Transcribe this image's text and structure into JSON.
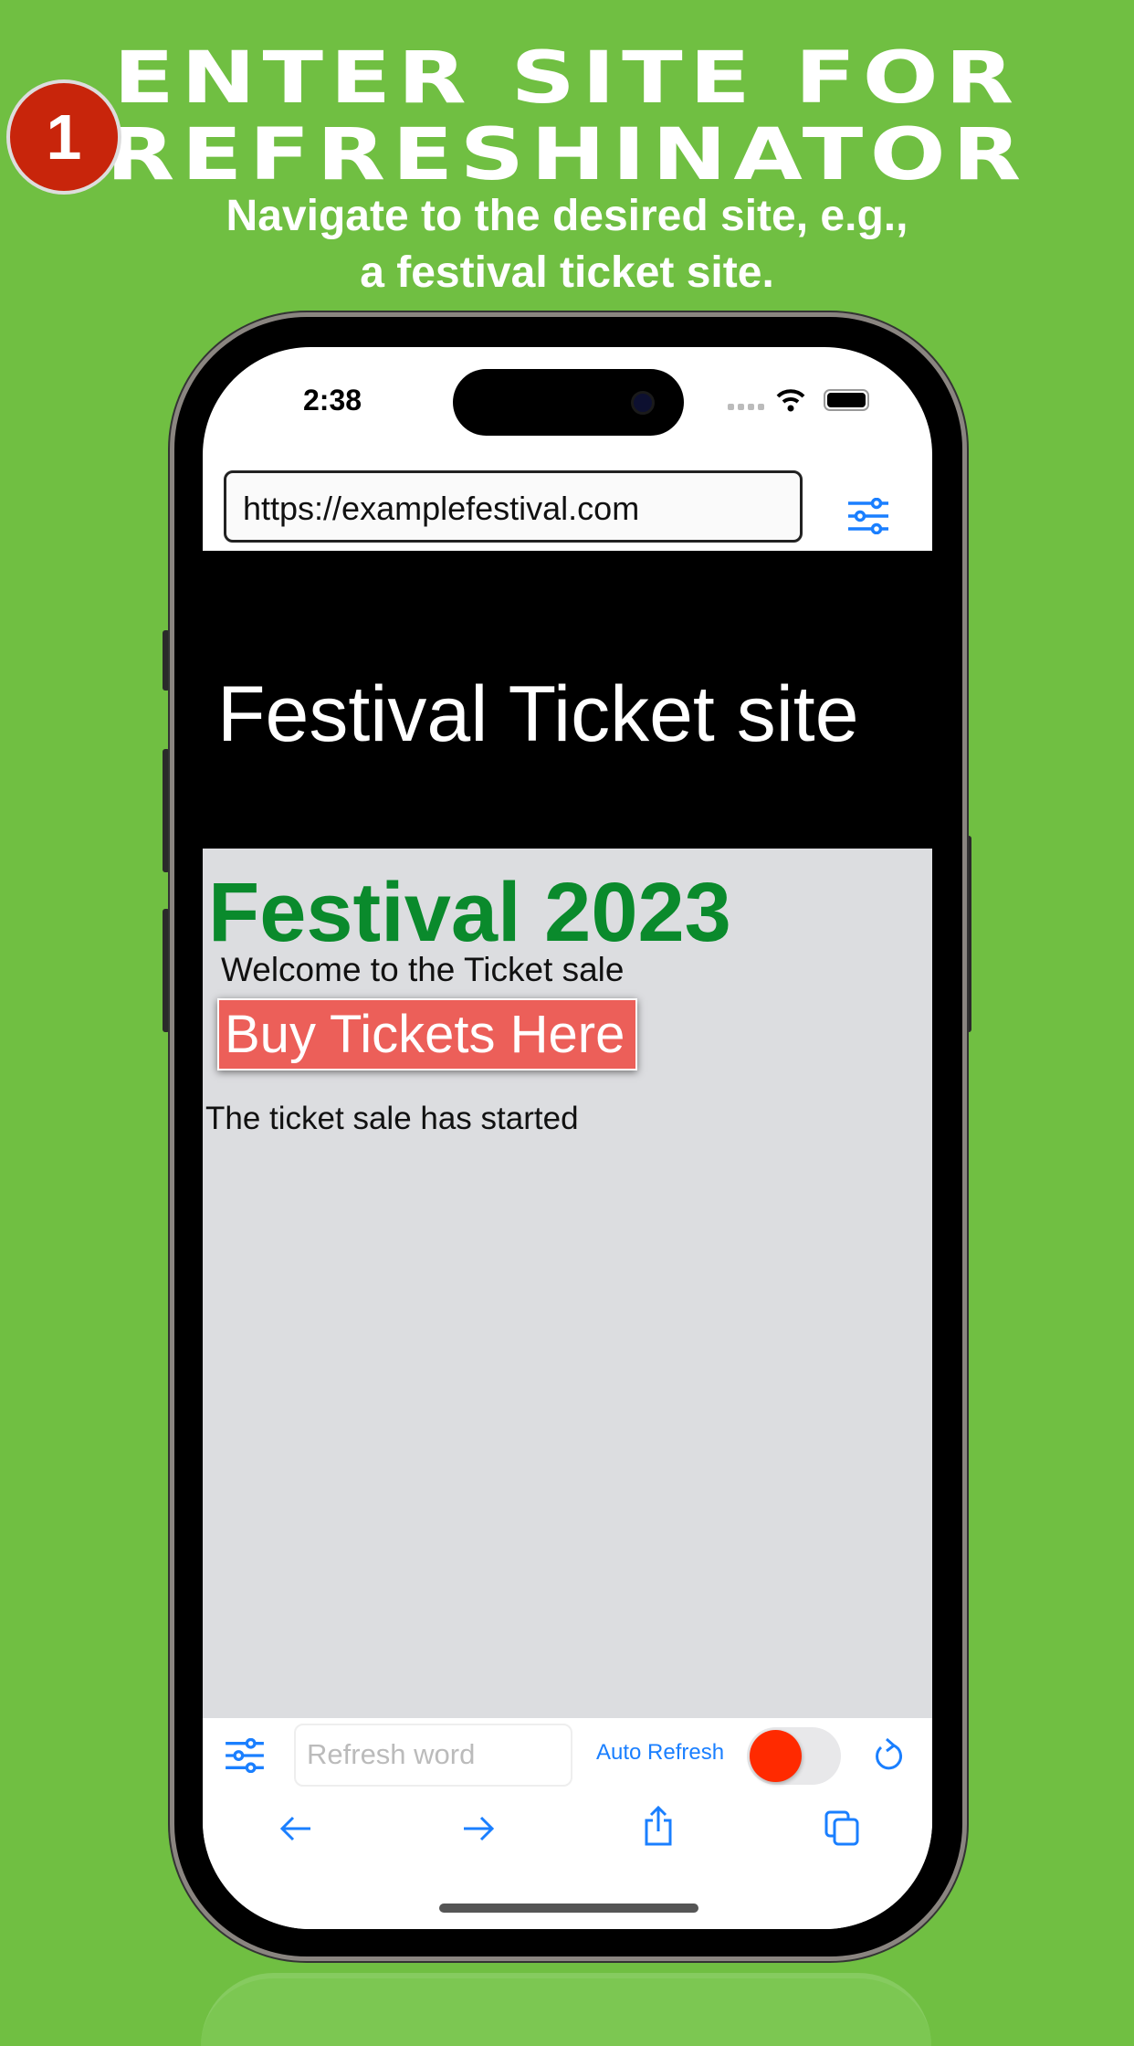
{
  "promo": {
    "step_number": "1",
    "title_line1": "ENTER SITE FOR",
    "title_line2": "REFRESHINATOR",
    "subtitle_line1": "Navigate to the desired site, e.g.,",
    "subtitle_line2": "a festival ticket site."
  },
  "status_bar": {
    "time": "2:38"
  },
  "browser": {
    "url": "https://examplefestival.com"
  },
  "site": {
    "header": "Festival Ticket site",
    "heading": "Festival 2023",
    "welcome": "Welcome to the Ticket sale",
    "buy_button": "Buy Tickets Here",
    "status": "The ticket sale has started"
  },
  "toolbar": {
    "refresh_word_placeholder": "Refresh word",
    "auto_refresh_label": "Auto Refresh",
    "auto_refresh_on": false
  },
  "colors": {
    "background": "#70bf42",
    "accent": "#1a7fff",
    "badge": "#c8250b",
    "heading": "#0a8a2c",
    "buy_button": "#ec5f59",
    "toggle_knob": "#ff2a00"
  },
  "icons": [
    "sliders-icon",
    "reload-icon",
    "back-arrow-icon",
    "forward-arrow-icon",
    "share-icon",
    "tabs-icon",
    "wifi-icon",
    "battery-icon"
  ]
}
